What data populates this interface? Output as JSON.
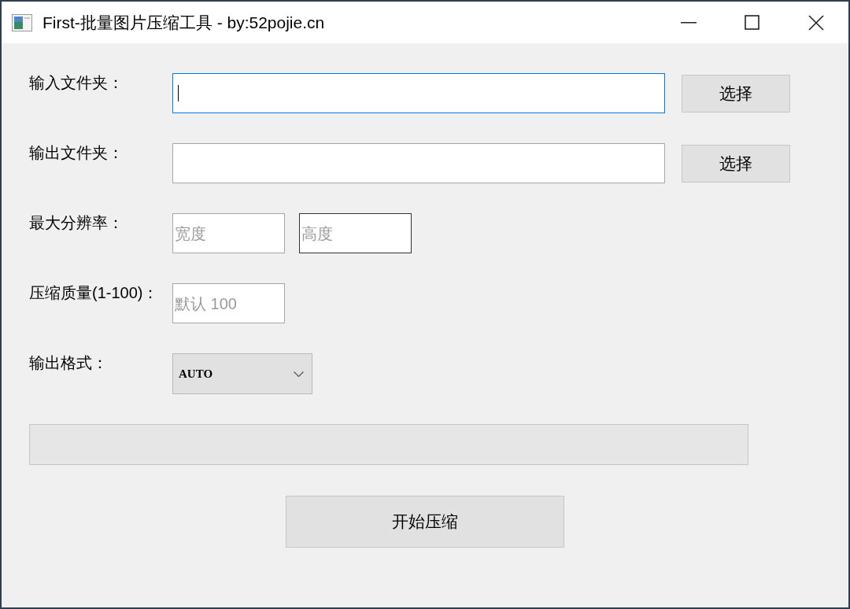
{
  "window": {
    "title": "First-批量图片压缩工具 - by:52pojie.cn"
  },
  "fields": [
    {
      "kind": "folder",
      "label": "输入文件夹：",
      "focused": true,
      "button": "选择"
    },
    {
      "kind": "folder",
      "label": "输出文件夹：",
      "focused": false,
      "button": "选择"
    },
    {
      "kind": "pair",
      "label": "最大分辨率：",
      "inputs": [
        {
          "placeholder": "宽度",
          "hovered": false
        },
        {
          "placeholder": "高度",
          "hovered": true
        }
      ]
    },
    {
      "kind": "number",
      "label": "压缩质量(1-100)：",
      "placeholder": "默认 100"
    },
    {
      "kind": "select",
      "label": "输出格式：",
      "value": "AUTO"
    }
  ],
  "progress": {
    "level": 0
  },
  "start_button": "开始压缩"
}
